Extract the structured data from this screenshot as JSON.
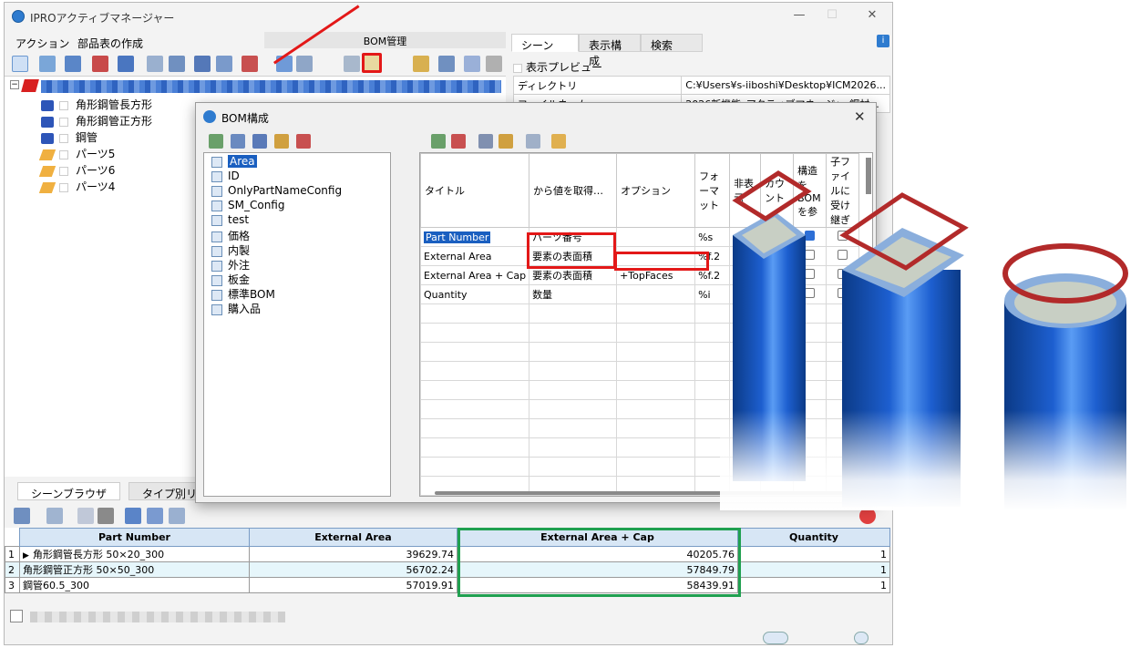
{
  "app": {
    "title": "IPROアクティブマネージャー"
  },
  "menu": [
    "アクション",
    "部品表の作成"
  ],
  "bom_tab": "BOM管理",
  "tree": {
    "items": [
      {
        "label": "角形鋼管長方形",
        "kind": "blue"
      },
      {
        "label": "角形鋼管正方形",
        "kind": "blue"
      },
      {
        "label": "鋼管",
        "kind": "blue"
      },
      {
        "label": "パーツ5",
        "kind": "orange"
      },
      {
        "label": "パーツ6",
        "kind": "orange"
      },
      {
        "label": "パーツ4",
        "kind": "orange"
      }
    ]
  },
  "right_panel": {
    "tabs": [
      "シーン",
      "表示構成",
      "検索"
    ],
    "preview_label": "表示プレビュー",
    "props": [
      {
        "key": "ディレクトリ",
        "value": "C:¥Users¥s-iiboshi¥Desktop¥ICM2026..."
      },
      {
        "key": "ファイルネーム",
        "value": "2026新機能_アクティブマネージャ_鋼材..."
      }
    ]
  },
  "bottom_tabs": [
    "シーンブラウザ",
    "タイプ別リスト"
  ],
  "dialog": {
    "title": "BOM構成",
    "list": [
      "Area",
      "ID",
      "OnlyPartNameConfig",
      "SM_Config",
      "test",
      "価格",
      "内製",
      "外注",
      "板金",
      "標準BOM",
      "購入品"
    ],
    "columns": [
      "タイトル",
      "から値を取得…",
      "オプション",
      "フォーマット",
      "非表示",
      "カウント",
      "構造をBOMを参",
      "子ファイルに受け継ぎ"
    ],
    "rows": [
      {
        "title": "Part Number",
        "source": "パーツ番号",
        "option": "",
        "format": "%s"
      },
      {
        "title": "External Area",
        "source": "要素の表面積",
        "option": "",
        "format": "%f.2"
      },
      {
        "title": "External Area + Cap",
        "source": "要素の表面積",
        "option": "+TopFaces",
        "format": "%f.2"
      },
      {
        "title": "Quantity",
        "source": "数量",
        "option": "",
        "format": "%i"
      }
    ]
  },
  "grid": {
    "headers": [
      "Part Number",
      "External Area",
      "External Area + Cap",
      "Quantity"
    ],
    "rows": [
      {
        "no": "1",
        "part": "角形鋼管長方形 50×20_300",
        "area": "39629.74",
        "cap": "40205.76",
        "qty": "1"
      },
      {
        "no": "2",
        "part": "角形鋼管正方形 50×50_300",
        "area": "56702.24",
        "cap": "57849.79",
        "qty": "1"
      },
      {
        "no": "3",
        "part": "鋼管60.5_300",
        "area": "57019.91",
        "cap": "58439.91",
        "qty": "1"
      }
    ]
  },
  "colors": {
    "accent_red": "#e31818",
    "accent_green": "#20a050",
    "tube_blue": "#1d5fd0",
    "ring_red": "#b22a2a"
  }
}
